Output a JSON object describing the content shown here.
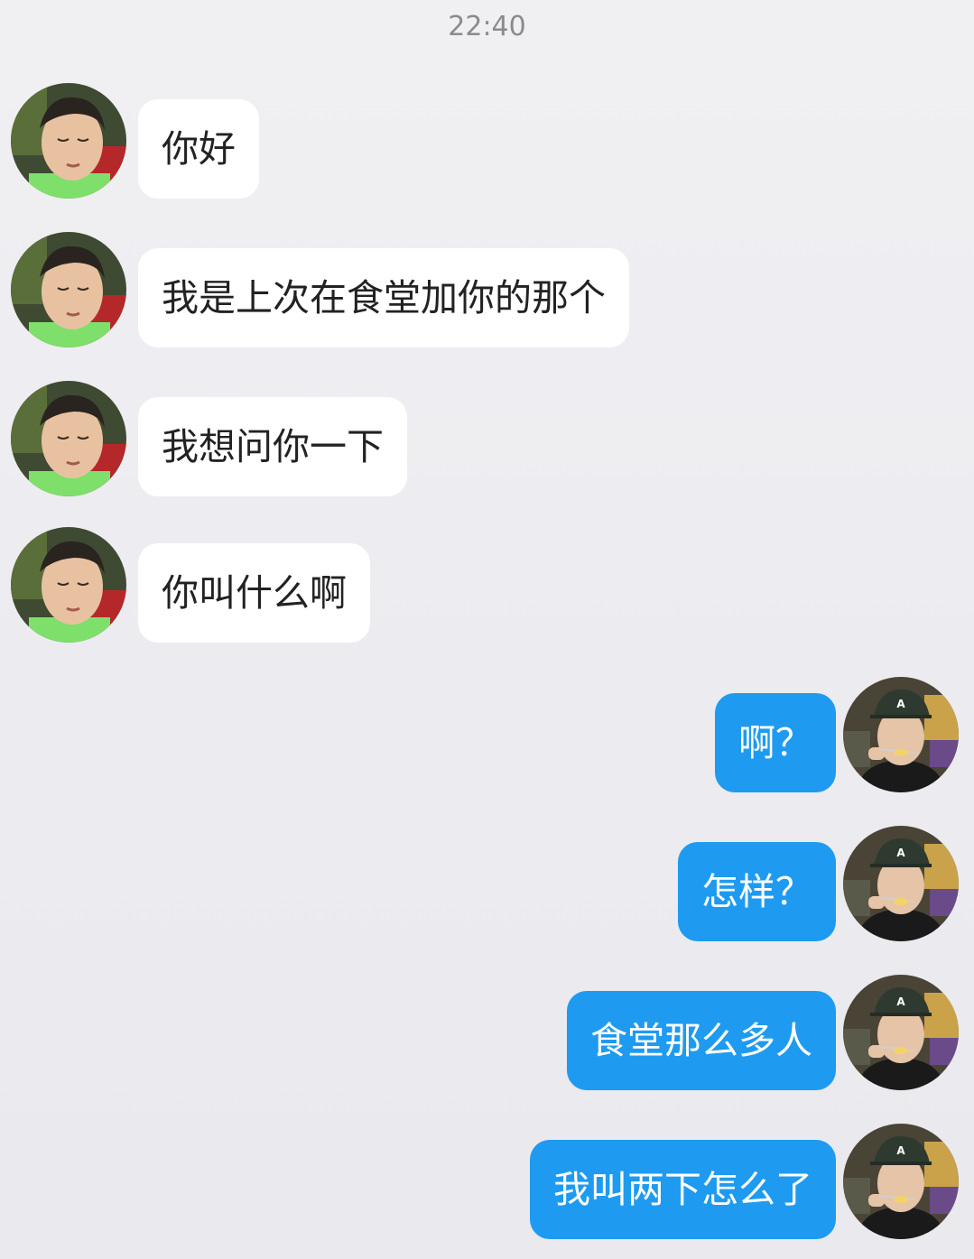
{
  "timestamp": "22:40",
  "colors": {
    "background": "#eeeef2",
    "incoming_bubble": "#ffffff",
    "outgoing_bubble": "#1e9bf0",
    "incoming_text": "#222222",
    "outgoing_text": "#ffffff",
    "timestamp_text": "#8a8a8f"
  },
  "messages": [
    {
      "direction": "incoming",
      "text": "你好"
    },
    {
      "direction": "incoming",
      "text": "我是上次在食堂加你的那个"
    },
    {
      "direction": "incoming",
      "text": "我想问你一下"
    },
    {
      "direction": "incoming",
      "text": "你叫什么啊"
    },
    {
      "direction": "outgoing",
      "text": "啊？"
    },
    {
      "direction": "outgoing",
      "text": "怎样？"
    },
    {
      "direction": "outgoing",
      "text": "食堂那么多人"
    },
    {
      "direction": "outgoing",
      "text": "我叫两下怎么了"
    }
  ]
}
